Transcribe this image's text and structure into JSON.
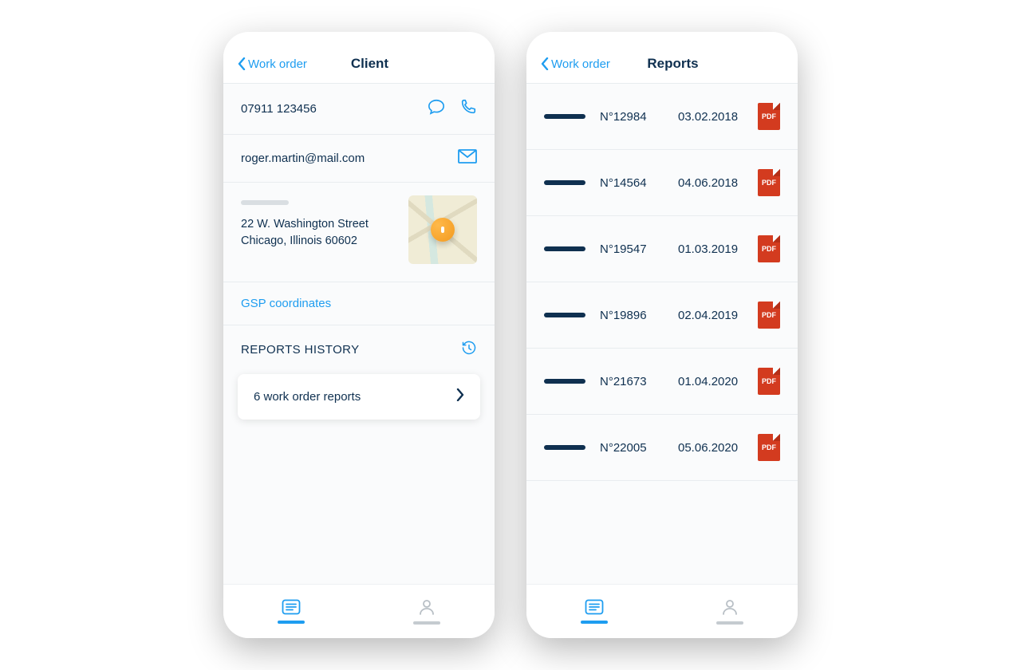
{
  "client": {
    "back_label": "Work order",
    "title": "Client",
    "phone": "07911 123456",
    "email": "roger.martin@mail.com",
    "address_line1": "22 W. Washington Street",
    "address_line2": "Chicago, Illinois 60602",
    "gsp_link": "GSP coordinates",
    "reports_header": "REPORTS HISTORY",
    "reports_card": "6 work order reports"
  },
  "reports": {
    "back_label": "Work order",
    "title": "Reports",
    "pdf_label": "PDF",
    "items": [
      {
        "number": "N°12984",
        "date": "03.02.2018"
      },
      {
        "number": "N°14564",
        "date": "04.06.2018"
      },
      {
        "number": "N°19547",
        "date": "01.03.2019"
      },
      {
        "number": "N°19896",
        "date": "02.04.2019"
      },
      {
        "number": "N°21673",
        "date": "01.04.2020"
      },
      {
        "number": "N°22005",
        "date": "05.06.2020"
      }
    ]
  },
  "colors": {
    "accent": "#1e9df0",
    "text": "#0f3050",
    "pdf": "#d33b1f",
    "pin": "#f39a1f"
  }
}
